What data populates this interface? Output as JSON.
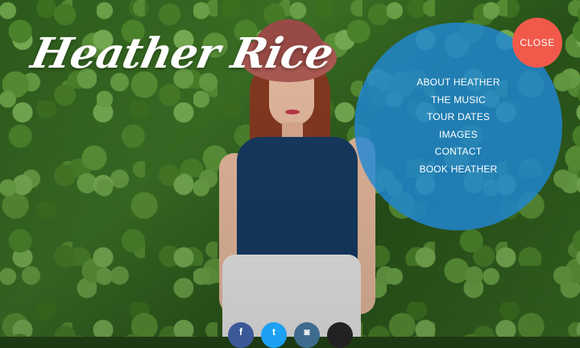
{
  "site": {
    "title": "Heather Rice"
  },
  "menu": {
    "items": [
      {
        "label": "ABOUT HEATHER"
      },
      {
        "label": "THE MUSIC"
      },
      {
        "label": "TOUR DATES"
      },
      {
        "label": "IMAGES"
      },
      {
        "label": "CONTACT"
      },
      {
        "label": "BOOK HEATHER"
      }
    ],
    "close_label": "CLOSE"
  },
  "colors": {
    "menu_circle": "#2088d4",
    "close_button": "#f15a4b",
    "facebook": "#3b5998",
    "twitter": "#1da1f2",
    "instagram": "#3f6b8f",
    "apple": "#222222"
  },
  "social": [
    {
      "icon": "facebook-icon",
      "glyph": "f"
    },
    {
      "icon": "twitter-icon",
      "glyph": "t"
    },
    {
      "icon": "instagram-icon",
      "glyph": "◙"
    },
    {
      "icon": "apple-icon",
      "glyph": ""
    }
  ]
}
